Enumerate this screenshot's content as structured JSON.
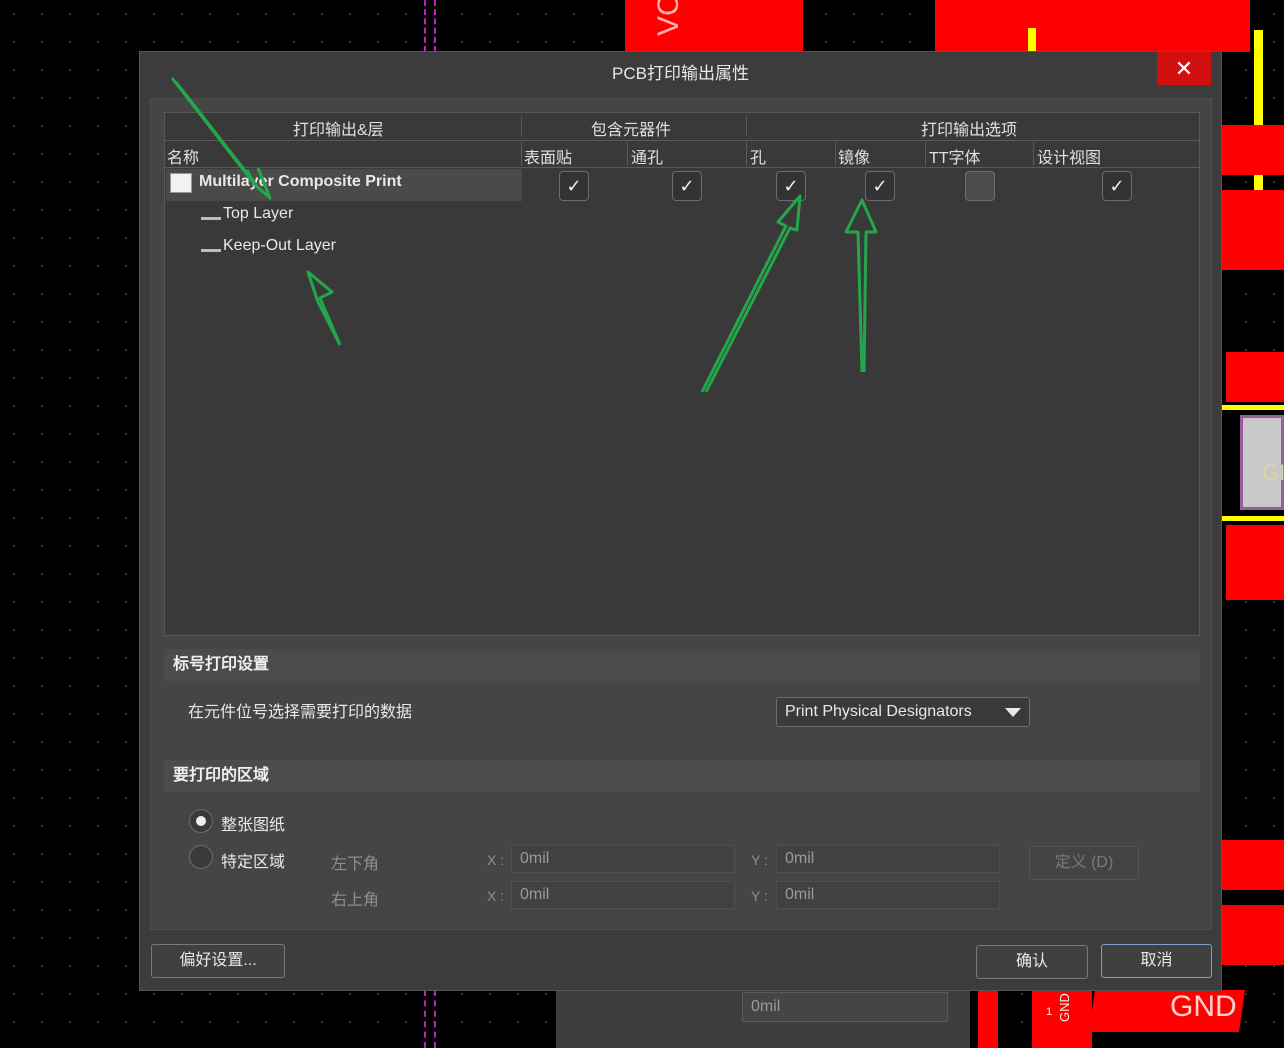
{
  "dialog": {
    "title": "PCB打印输出属性",
    "close_glyph": "✕"
  },
  "table": {
    "group_headers": [
      "打印输出&层",
      "包含元器件",
      "打印输出选项"
    ],
    "col_headers": [
      "名称",
      "表面贴",
      "通孔",
      "孔",
      "镜像",
      "TT字体",
      "设计视图"
    ],
    "rows": [
      {
        "name": "Multilayer Composite Print",
        "checks": [
          true,
          true,
          true,
          true,
          false,
          true
        ]
      },
      {
        "name": "Top Layer"
      },
      {
        "name": "Keep-Out Layer"
      }
    ],
    "check_glyph": "✓"
  },
  "designator": {
    "section": "标号打印设置",
    "label": "在元件位号选择需要打印的数据",
    "dropdown_value": "Print Physical Designators"
  },
  "area": {
    "section": "要打印的区域",
    "option_whole": "整张图纸",
    "option_specific": "特定区域",
    "selected": "整张图纸",
    "bottom_left_label": "左下角",
    "top_right_label": "右上角",
    "x_label": "X :",
    "y_label": "Y :",
    "bl_x": "0mil",
    "bl_y": "0mil",
    "tr_x": "0mil",
    "tr_y": "0mil",
    "define_button": "定义 (D)"
  },
  "footer": {
    "preferences_button": "偏好设置...",
    "ok_button": "确认",
    "cancel_button": "取消"
  },
  "background": {
    "label_vcc": "VC",
    "label_gnd": "GND",
    "label_gnd_small": "GND",
    "label_one": "1",
    "label_gi": "GI",
    "field_value": "0mil"
  },
  "colors": {
    "dialog_bg": "#3c3c3c",
    "accent_close": "#d10f0f",
    "pcb_red": "#ff0000",
    "arrow_green": "#22a84a"
  }
}
